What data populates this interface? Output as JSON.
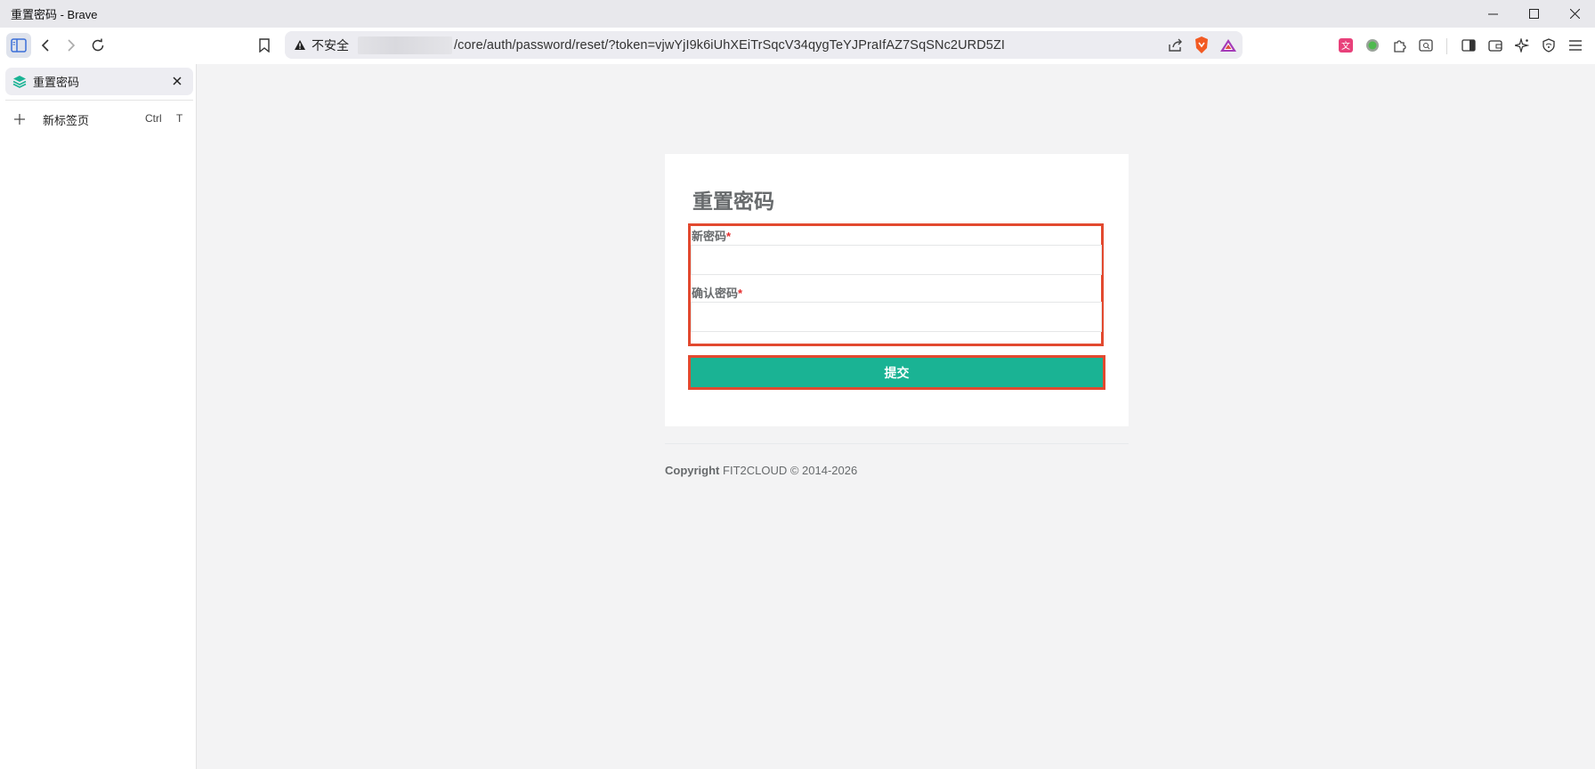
{
  "window": {
    "title": "重置密码 - Brave"
  },
  "toolbar": {
    "security_label": "不安全",
    "url_path": "/core/auth/password/reset/?token=vjwYjI9k6iUhXEiTrSqcV34qygTeYJPraIfAZ7SqSNc2URD5ZI"
  },
  "sidebar": {
    "tab_title": "重置密码",
    "new_tab_label": "新标签页",
    "shortcut_ctrl": "Ctrl",
    "shortcut_key": "T"
  },
  "page": {
    "heading": "重置密码",
    "new_password_label": "新密码",
    "confirm_password_label": "确认密码",
    "required_mark": "*",
    "new_password_value": "",
    "confirm_password_value": "",
    "submit_label": "提交",
    "copyright_prefix": "Copyright",
    "copyright_text": "FIT2CLOUD © 2014-2026"
  },
  "colors": {
    "accent_teal": "#1ab394",
    "highlight_red": "#e2492f",
    "required_red": "#e52b2b"
  }
}
